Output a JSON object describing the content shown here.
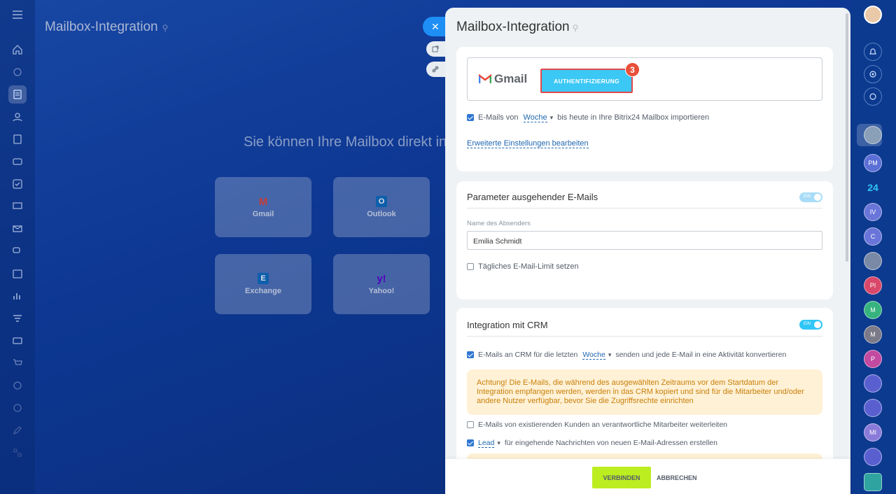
{
  "app": {
    "title": "Mailbox-Integration",
    "background_message": "Sie können Ihre Mailbox direkt in",
    "providers": [
      {
        "name": "Gmail",
        "icon": "gmail-icon",
        "glyph": "M",
        "color": "#ea4335"
      },
      {
        "name": "Outlook",
        "icon": "outlook-icon",
        "glyph": "O",
        "color": "#0f6cbd"
      },
      {
        "name": "Exchange",
        "icon": "exchange-icon",
        "glyph": "E",
        "color": "#0f6cbd"
      },
      {
        "name": "Yahoo!",
        "icon": "yahoo-icon",
        "glyph": "y!",
        "color": "#6001d2"
      }
    ]
  },
  "panel": {
    "title": "Mailbox-Integration",
    "auth": {
      "provider_name": "Gmail",
      "button_label": "AUTHENTIFIZIERUNG",
      "step_badge": "3",
      "import_prefix": "E-Mails von",
      "import_period": "Woche",
      "import_suffix": "bis heute in Ihre Bitrix24 Mailbox importieren",
      "import_checked": true,
      "advanced_link": "Erweiterte Einstellungen bearbeiten"
    },
    "outgoing": {
      "title": "Parameter ausgehender E-Mails",
      "toggle_label": "EIN",
      "toggle_on": false,
      "sender_label": "Name des Absenders",
      "sender_value": "Emilia Schmidt",
      "limit_label": "Tägliches E-Mail-Limit setzen",
      "limit_checked": false
    },
    "crm": {
      "title": "Integration mit CRM",
      "toggle_label": "EIN",
      "toggle_on": true,
      "send_prefix": "E-Mails an CRM für die letzten",
      "send_period": "Woche",
      "send_suffix": "senden und jede E-Mail in eine Aktivität konvertieren",
      "warning": "Achtung! Die E-Mails, die während des ausgewählten Zeitraums vor dem Startdatum der Integration empfangen werden, werden in das CRM kopiert und sind für die Mitarbeiter und/oder andere Nutzer verfügbar, bevor Sie die Zugriffsrechte einrichten",
      "forward_label": "E-Mails von existierenden Kunden an verantwortliche Mitarbeiter weiterleiten",
      "lead_select": "Lead",
      "lead_suffix": "für eingehende Nachrichten von neuen E-Mail-Adressen erstellen"
    },
    "footer": {
      "connect_label": "VERBINDEN",
      "cancel_label": "ABBRECHEN"
    }
  },
  "right_bar": {
    "avatars": [
      {
        "initials": "",
        "color": "#8aa0b8"
      },
      {
        "initials": "PM",
        "color": "#5b6fd6"
      },
      {
        "initials": "24",
        "color": "transparent"
      },
      {
        "initials": "IV",
        "color": "#6a75d9"
      },
      {
        "initials": "C",
        "color": "#6a75d9"
      },
      {
        "initials": "",
        "color": "#7a8aa6"
      },
      {
        "initials": "PI",
        "color": "#d9486a"
      },
      {
        "initials": "M",
        "color": "#36b37e"
      },
      {
        "initials": "M",
        "color": "#7a7a88"
      },
      {
        "initials": "P",
        "color": "#c24aa0"
      },
      {
        "initials": "",
        "color": "#5a5fd0"
      },
      {
        "initials": "",
        "color": "#5a5fd0"
      },
      {
        "initials": "MI",
        "color": "#8a7ad9"
      },
      {
        "initials": "",
        "color": "#5a5fd0"
      },
      {
        "initials": "",
        "color": "#2fa3a0"
      }
    ]
  }
}
